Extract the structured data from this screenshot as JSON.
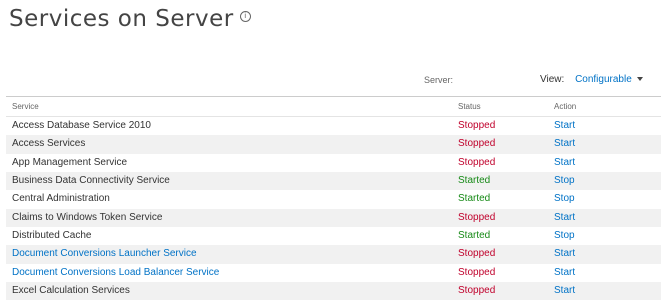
{
  "page": {
    "title": "Services on Server",
    "info_icon": "info-icon"
  },
  "toolbar": {
    "server_label": "Server:",
    "view_label": "View:",
    "view_value": "Configurable"
  },
  "table": {
    "headers": {
      "service": "Service",
      "status": "Status",
      "action": "Action"
    },
    "rows": [
      {
        "service": "Access Database Service 2010",
        "status": "Stopped",
        "action": "Start",
        "service_is_link": false
      },
      {
        "service": "Access Services",
        "status": "Stopped",
        "action": "Start",
        "service_is_link": false
      },
      {
        "service": "App Management Service",
        "status": "Stopped",
        "action": "Start",
        "service_is_link": false
      },
      {
        "service": "Business Data Connectivity Service",
        "status": "Started",
        "action": "Stop",
        "service_is_link": false
      },
      {
        "service": "Central Administration",
        "status": "Started",
        "action": "Stop",
        "service_is_link": false
      },
      {
        "service": "Claims to Windows Token Service",
        "status": "Stopped",
        "action": "Start",
        "service_is_link": false
      },
      {
        "service": "Distributed Cache",
        "status": "Started",
        "action": "Stop",
        "service_is_link": false
      },
      {
        "service": "Document Conversions Launcher Service",
        "status": "Stopped",
        "action": "Start",
        "service_is_link": true
      },
      {
        "service": "Document Conversions Load Balancer Service",
        "status": "Stopped",
        "action": "Start",
        "service_is_link": true
      },
      {
        "service": "Excel Calculation Services",
        "status": "Stopped",
        "action": "Start",
        "service_is_link": false
      }
    ]
  },
  "colors": {
    "link": "#0072c6",
    "stopped": "#c0002b",
    "started": "#178a17",
    "alt_row": "#f1f1f1"
  }
}
